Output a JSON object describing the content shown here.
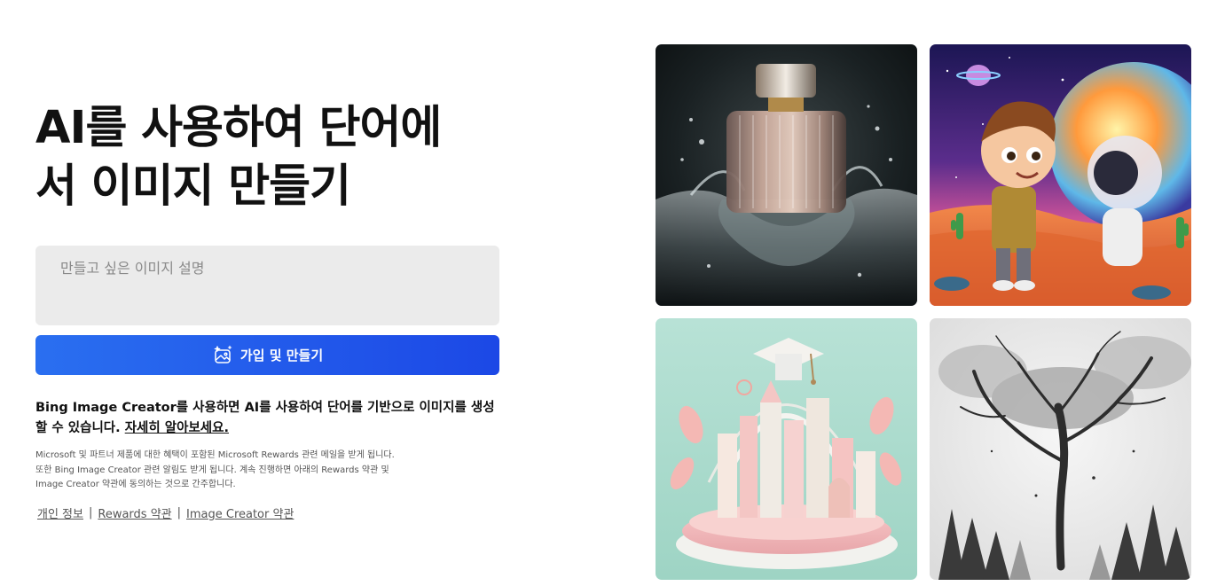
{
  "hero": {
    "title_line1": "AI를 사용하여 단어에",
    "title_line2": "서 이미지 만들기"
  },
  "prompt": {
    "placeholder": "만들고 싶은 이미지 설명"
  },
  "create_button": {
    "label": "가입 및 만들기",
    "icon": "sparkle-image-icon"
  },
  "description": {
    "text": "Bing Image Creator를 사용하면 AI를 사용하여 단어를 기반으로 이미지를 생성할 수 있습니다. ",
    "link_label": "자세히 알아보세요."
  },
  "fine_print": {
    "line1": "Microsoft 및 파트너 제품에 대한 혜택이 포함된 Microsoft Rewards 관련 메일을 받게 됩니다.",
    "line2": "또한 Bing Image Creator 관련 알림도 받게 됩니다. 계속 진행하면 아래의 Rewards 약관 및",
    "line3": "Image Creator 약관에 동의하는 것으로 간주합니다."
  },
  "footer_links": {
    "privacy": "개인 정보",
    "rewards_terms": "Rewards 약관",
    "creator_terms": "Image Creator 약관",
    "separator": "|"
  },
  "gallery": {
    "images": [
      "perfume-bottle-splash-image",
      "cartoon-boy-astronaut-desert-image",
      "pastel-graduation-cityscape-image",
      "ink-wash-tree-forest-image"
    ]
  },
  "colors": {
    "button_start": "#2a6ff0",
    "button_end": "#1c48e6",
    "input_bg": "#ebebeb"
  }
}
